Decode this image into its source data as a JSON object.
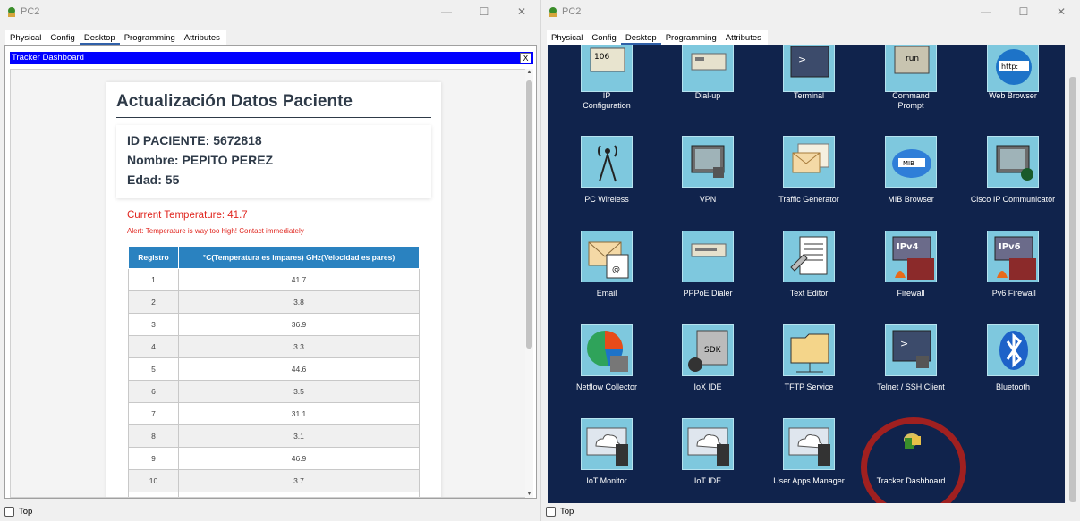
{
  "left_window": {
    "title": "PC2",
    "window_controls": {
      "minimize": "—",
      "maximize": "☐",
      "close": "✕"
    },
    "tabs": [
      "Physical",
      "Config",
      "Desktop",
      "Programming",
      "Attributes"
    ],
    "active_tab": "Desktop",
    "inner_window": {
      "title": "Tracker Dashboard",
      "close_label": "X"
    },
    "dashboard": {
      "heading": "Actualización Datos Paciente",
      "patient_id": "ID PACIENTE: 5672818",
      "patient_name": "Nombre: PEPITO PEREZ",
      "patient_age": "Edad: 55",
      "current_temperature": "Current Temperature: 41.7",
      "alert": "Alert: Temperature is way too high! Contact immediately",
      "table": {
        "headers": [
          "Registro",
          "°C(Temperatura es impares) GHz(Velocidad es pares)"
        ],
        "rows": [
          [
            "1",
            "41.7"
          ],
          [
            "2",
            "3.8"
          ],
          [
            "3",
            "36.9"
          ],
          [
            "4",
            "3.3"
          ],
          [
            "5",
            "44.6"
          ],
          [
            "6",
            "3.5"
          ],
          [
            "7",
            "31.1"
          ],
          [
            "8",
            "3.1"
          ],
          [
            "9",
            "46.9"
          ],
          [
            "10",
            "3.7"
          ]
        ]
      }
    },
    "bottom_checkbox_label": "Top"
  },
  "right_window": {
    "title": "PC2",
    "window_controls": {
      "minimize": "—",
      "maximize": "☐",
      "close": "✕"
    },
    "tabs": [
      "Physical",
      "Config",
      "Desktop",
      "Programming",
      "Attributes"
    ],
    "active_tab": "Desktop",
    "apps": [
      {
        "label": "IP\nConfiguration",
        "icon": "ip-configuration-icon"
      },
      {
        "label": "Dial-up",
        "icon": "dial-up-icon"
      },
      {
        "label": "Terminal",
        "icon": "terminal-icon"
      },
      {
        "label": "Command\nPrompt",
        "icon": "command-prompt-icon"
      },
      {
        "label": "Web Browser",
        "icon": "web-browser-icon"
      },
      {
        "label": "PC Wireless",
        "icon": "pc-wireless-icon"
      },
      {
        "label": "VPN",
        "icon": "vpn-icon"
      },
      {
        "label": "Traffic Generator",
        "icon": "traffic-generator-icon"
      },
      {
        "label": "MIB Browser",
        "icon": "mib-browser-icon"
      },
      {
        "label": "Cisco IP Communicator",
        "icon": "cisco-ip-communicator-icon"
      },
      {
        "label": "Email",
        "icon": "email-icon"
      },
      {
        "label": "PPPoE Dialer",
        "icon": "pppoe-dialer-icon"
      },
      {
        "label": "Text Editor",
        "icon": "text-editor-icon"
      },
      {
        "label": "Firewall",
        "icon": "firewall-icon"
      },
      {
        "label": "IPv6 Firewall",
        "icon": "ipv6-firewall-icon"
      },
      {
        "label": "Netflow Collector",
        "icon": "netflow-collector-icon"
      },
      {
        "label": "IoX IDE",
        "icon": "iox-ide-icon"
      },
      {
        "label": "TFTP Service",
        "icon": "tftp-service-icon"
      },
      {
        "label": "Telnet / SSH Client",
        "icon": "telnet-ssh-client-icon"
      },
      {
        "label": "Bluetooth",
        "icon": "bluetooth-icon"
      },
      {
        "label": "IoT Monitor",
        "icon": "iot-monitor-icon"
      },
      {
        "label": "IoT IDE",
        "icon": "iot-ide-icon"
      },
      {
        "label": "User Apps Manager",
        "icon": "user-apps-manager-icon"
      },
      {
        "label": "Tracker Dashboard",
        "icon": "tracker-dashboard-icon"
      }
    ],
    "icon_texts": {
      "ip_config": "106",
      "command_prompt": "run",
      "web_browser": "http:",
      "mib": "MIB",
      "ipv4": "IPv4",
      "ipv6": "IPv6",
      "sdk": "SDK",
      "email_at": "@",
      "terminal_prompt": ">"
    },
    "highlight_color": "#a02020",
    "bottom_checkbox_label": "Top"
  }
}
